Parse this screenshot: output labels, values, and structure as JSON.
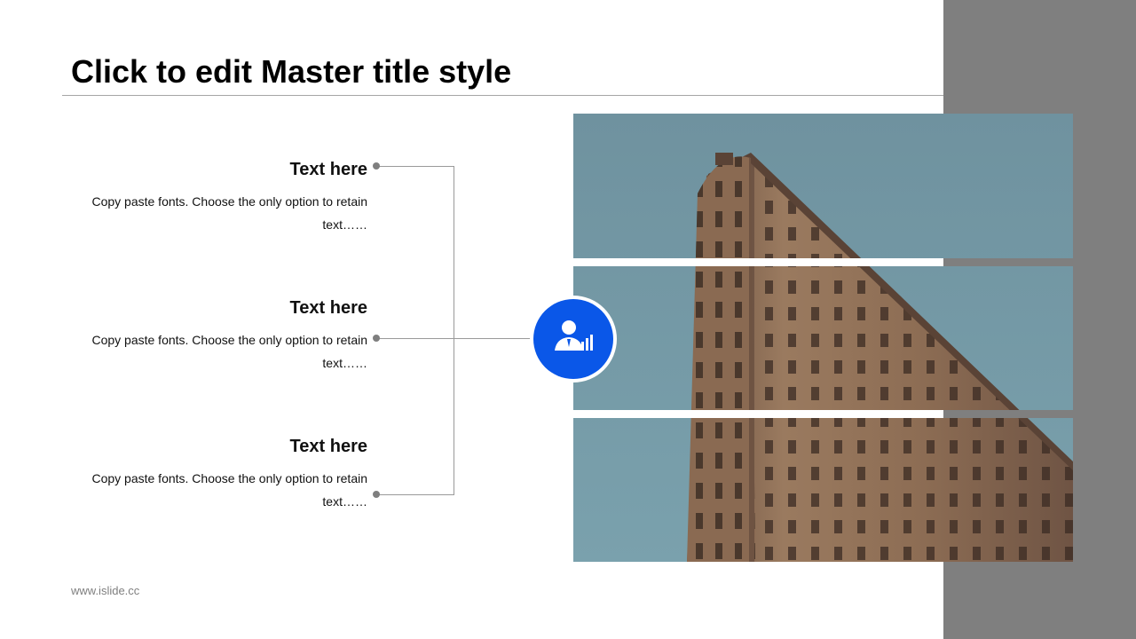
{
  "slide": {
    "title": "Click to edit Master title style",
    "footer": "www.islide.cc"
  },
  "items": [
    {
      "heading": "Text here",
      "body": "Copy paste fonts. Choose the only option to retain text……"
    },
    {
      "heading": "Text here",
      "body": "Copy paste fonts. Choose the only option to retain text……"
    },
    {
      "heading": "Text here",
      "body": "Copy paste fonts. Choose the only option to retain text……"
    }
  ],
  "hub": {
    "icon": "user-analytics-icon",
    "color": "#0a57e8"
  },
  "photo": {
    "subject": "",
    "sky_color": "#7295a3",
    "building_color": "#8a6b52"
  },
  "colors": {
    "side_panel": "#7f7f7f",
    "rule": "#a6a6a6"
  }
}
